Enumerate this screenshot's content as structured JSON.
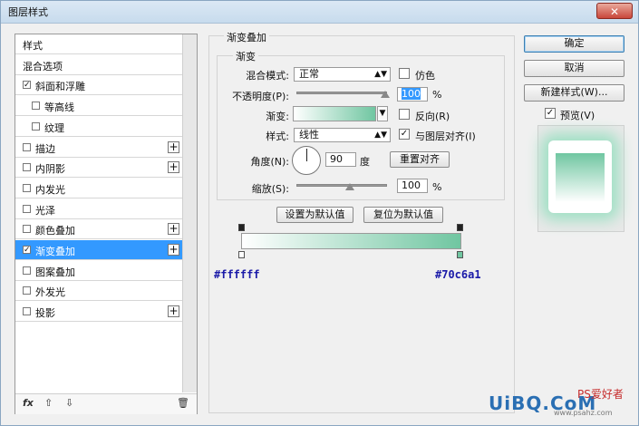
{
  "window": {
    "title": "图层样式",
    "close": "✕"
  },
  "left_panel": {
    "items": [
      {
        "label": "样式",
        "checkbox": false,
        "checked": false,
        "plus": false,
        "indent": 0
      },
      {
        "label": "混合选项",
        "checkbox": false,
        "checked": false,
        "plus": false,
        "indent": 0
      },
      {
        "label": "斜面和浮雕",
        "checkbox": true,
        "checked": true,
        "plus": false,
        "indent": 0
      },
      {
        "label": "等高线",
        "checkbox": true,
        "checked": false,
        "plus": false,
        "indent": 1
      },
      {
        "label": "纹理",
        "checkbox": true,
        "checked": false,
        "plus": false,
        "indent": 1
      },
      {
        "label": "描边",
        "checkbox": true,
        "checked": false,
        "plus": true,
        "indent": 0
      },
      {
        "label": "内阴影",
        "checkbox": true,
        "checked": false,
        "plus": true,
        "indent": 0
      },
      {
        "label": "内发光",
        "checkbox": true,
        "checked": false,
        "plus": false,
        "indent": 0
      },
      {
        "label": "光泽",
        "checkbox": true,
        "checked": false,
        "plus": false,
        "indent": 0
      },
      {
        "label": "颜色叠加",
        "checkbox": true,
        "checked": false,
        "plus": true,
        "indent": 0
      },
      {
        "label": "渐变叠加",
        "checkbox": true,
        "checked": true,
        "plus": true,
        "indent": 0,
        "active": true
      },
      {
        "label": "图案叠加",
        "checkbox": true,
        "checked": false,
        "plus": false,
        "indent": 0
      },
      {
        "label": "外发光",
        "checkbox": true,
        "checked": false,
        "plus": false,
        "indent": 0
      },
      {
        "label": "投影",
        "checkbox": true,
        "checked": false,
        "plus": true,
        "indent": 0
      }
    ],
    "toolbar": {
      "fx": "fx",
      "up": "⇧",
      "down": "⇩",
      "trash": "🗑"
    }
  },
  "gradient_overlay": {
    "group_title": "渐变叠加",
    "sub_title": "渐变",
    "blend_mode_label": "混合模式:",
    "blend_mode_value": "正常",
    "dither_label": "仿色",
    "dither_checked": false,
    "opacity_label": "不透明度(P):",
    "opacity_value": "100",
    "percent": "%",
    "gradient_label": "渐变:",
    "reverse_label": "反向(R)",
    "reverse_checked": false,
    "style_label": "样式:",
    "style_value": "线性",
    "align_label": "与图层对齐(I)",
    "align_checked": true,
    "angle_label": "角度(N):",
    "angle_value": "90",
    "angle_unit": "度",
    "reset_align_button": "重置对齐",
    "scale_label": "缩放(S):",
    "scale_value": "100",
    "set_default_button": "设置为默认值",
    "reset_default_button": "复位为默认值",
    "color_start": "#ffffff",
    "color_end": "#70c6a1",
    "hex_start": "#ffffff",
    "hex_end": "#70c6a1"
  },
  "right_panel": {
    "ok_button": "确定",
    "cancel_button": "取消",
    "new_style_button": "新建样式(W)...",
    "preview_label": "预览(V)",
    "preview_checked": true
  },
  "watermark": {
    "logo": "UiBQ.CoM",
    "cn": "PS爱好者",
    "sub": "www.psahz.com"
  }
}
